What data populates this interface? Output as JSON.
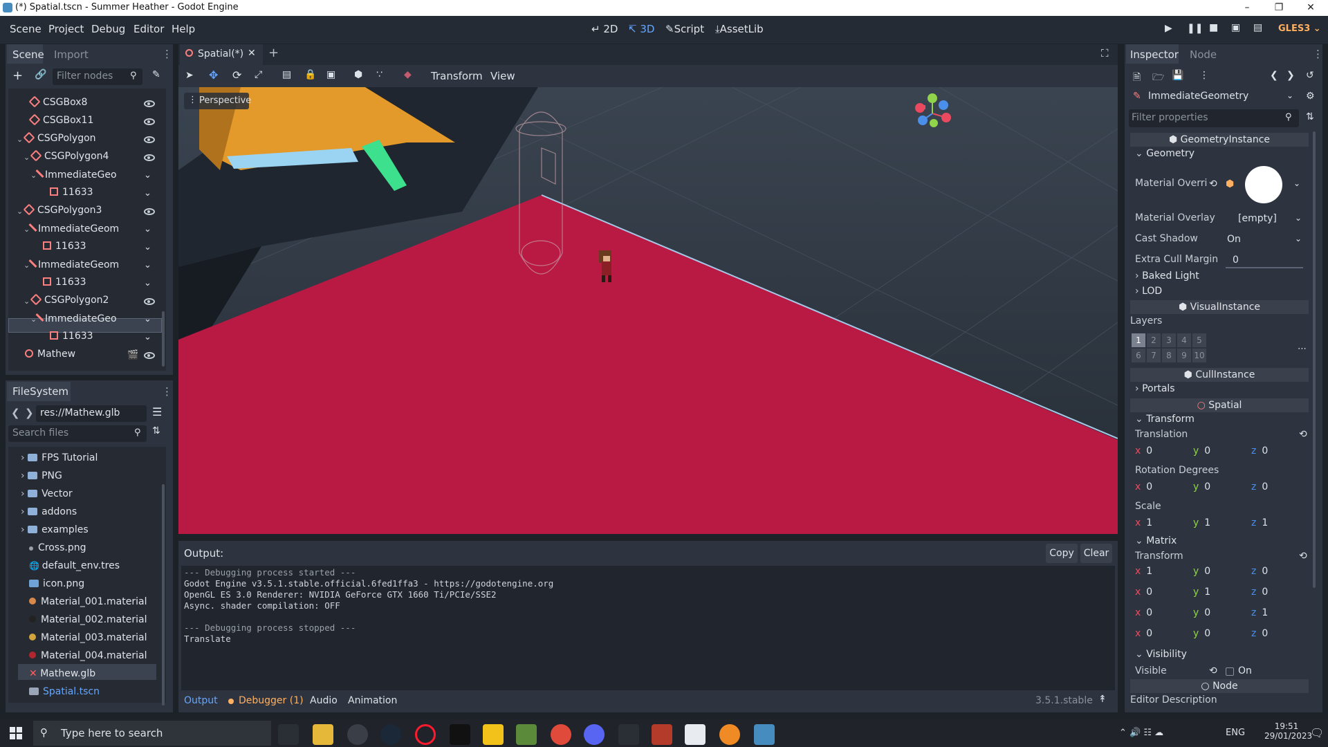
{
  "window": {
    "title": "(*) Spatial.tscn - Summer Heather - Godot Engine"
  },
  "menu": {
    "items": [
      "Scene",
      "Project",
      "Debug",
      "Editor",
      "Help"
    ]
  },
  "modes": {
    "d2": "2D",
    "d3": "3D",
    "script": "Script",
    "assetlib": "AssetLib"
  },
  "renderer": "GLES3",
  "scene_dock": {
    "tabs": [
      "Scene",
      "Import"
    ],
    "filter_placeholder": "Filter nodes",
    "nodes": [
      {
        "label": "CSGBox8",
        "icon": "csg-box-icon"
      },
      {
        "label": "CSGBox11",
        "icon": "csg-box-icon"
      },
      {
        "label": "CSGPolygon",
        "icon": "csg-polygon-icon"
      },
      {
        "label": "CSGPolygon4",
        "icon": "csg-polygon-icon"
      },
      {
        "label": "ImmediateGeo",
        "icon": "immediate-geometry-icon"
      },
      {
        "label": "11633",
        "icon": "mesh-icon"
      },
      {
        "label": "CSGPolygon3",
        "icon": "csg-polygon-icon"
      },
      {
        "label": "ImmediateGeom",
        "icon": "immediate-geometry-icon"
      },
      {
        "label": "11633",
        "icon": "mesh-icon"
      },
      {
        "label": "ImmediateGeom",
        "icon": "immediate-geometry-icon"
      },
      {
        "label": "11633",
        "icon": "mesh-icon"
      },
      {
        "label": "CSGPolygon2",
        "icon": "csg-polygon-icon"
      },
      {
        "label": "ImmediateGeo",
        "icon": "immediate-geometry-icon"
      },
      {
        "label": "11633",
        "icon": "mesh-icon"
      },
      {
        "label": "Mathew",
        "icon": "spatial-icon"
      }
    ]
  },
  "filesystem": {
    "title": "FileSystem",
    "path": "res://Mathew.glb",
    "search_placeholder": "Search files",
    "items": [
      {
        "label": "FPS Tutorial",
        "type": "folder"
      },
      {
        "label": "PNG",
        "type": "folder"
      },
      {
        "label": "Vector",
        "type": "folder"
      },
      {
        "label": "addons",
        "type": "folder"
      },
      {
        "label": "examples",
        "type": "folder"
      },
      {
        "label": "Cross.png",
        "type": "file"
      },
      {
        "label": "default_env.tres",
        "type": "env"
      },
      {
        "label": "icon.png",
        "type": "image"
      },
      {
        "label": "Material_001.material",
        "type": "material",
        "color": "#d9884b"
      },
      {
        "label": "Material_002.material",
        "type": "material",
        "color": "#222222"
      },
      {
        "label": "Material_003.material",
        "type": "material",
        "color": "#d1a53b"
      },
      {
        "label": "Material_004.material",
        "type": "material",
        "color": "#b3262d"
      },
      {
        "label": "Mathew.glb",
        "type": "scene-error"
      },
      {
        "label": "Spatial.tscn",
        "type": "scene"
      }
    ]
  },
  "editor_tab": {
    "label": "Spatial(*)"
  },
  "viewport_toolbar": {
    "transform": "Transform",
    "view": "View",
    "perspective": "Perspective"
  },
  "output": {
    "title": "Output:",
    "copy": "Copy",
    "clear": "Clear",
    "lines": [
      "--- Debugging process started ---",
      "Godot Engine v3.5.1.stable.official.6fed1ffa3 - https://godotengine.org",
      "OpenGL ES 3.0 Renderer: NVIDIA GeForce GTX 1660 Ti/PCIe/SSE2",
      "Async. shader compilation: OFF",
      "",
      "--- Debugging process stopped ---",
      "Translate"
    ]
  },
  "bottom_tabs": {
    "output": "Output",
    "debugger": "Debugger (1)",
    "audio": "Audio",
    "animation": "Animation",
    "version": "3.5.1.stable"
  },
  "inspector": {
    "tabs": [
      "Inspector",
      "Node"
    ],
    "object": "ImmediateGeometry",
    "filter_placeholder": "Filter properties",
    "geometry_instance": "GeometryInstance",
    "geometry": "Geometry",
    "material_override": "Material Overri",
    "material_overlay": "Material Overlay",
    "material_overlay_value": "[empty]",
    "cast_shadow": "Cast Shadow",
    "cast_shadow_value": "On",
    "extra_cull_margin": "Extra Cull Margin",
    "extra_cull_margin_value": "0",
    "baked_light": "Baked Light",
    "lod": "LOD",
    "visual_instance": "VisualInstance",
    "layers": "Layers",
    "layer_numbers": [
      "1",
      "2",
      "3",
      "4",
      "5",
      "6",
      "7",
      "8",
      "9",
      "10"
    ],
    "cull_instance": "CullInstance",
    "portals": "Portals",
    "spatial": "Spatial",
    "transform_section": "Transform",
    "translation": "Translation",
    "translation_values": [
      "0",
      "0",
      "0"
    ],
    "rotation": "Rotation Degrees",
    "rotation_values": [
      "0",
      "0",
      "0"
    ],
    "scale": "Scale",
    "scale_values": [
      "1",
      "1",
      "1"
    ],
    "matrix": "Matrix",
    "transform": "Transform",
    "matrix_rows": [
      [
        "1",
        "0",
        "0"
      ],
      [
        "0",
        "1",
        "0"
      ],
      [
        "0",
        "0",
        "1"
      ],
      [
        "0",
        "0",
        "0"
      ]
    ],
    "visibility": "Visibility",
    "visible": "Visible",
    "visible_value": "On",
    "node": "Node",
    "editor_description": "Editor Description"
  },
  "taskbar": {
    "search_placeholder": "Type here to search",
    "lang": "ENG",
    "time": "19:51",
    "date": "29/01/2023"
  }
}
